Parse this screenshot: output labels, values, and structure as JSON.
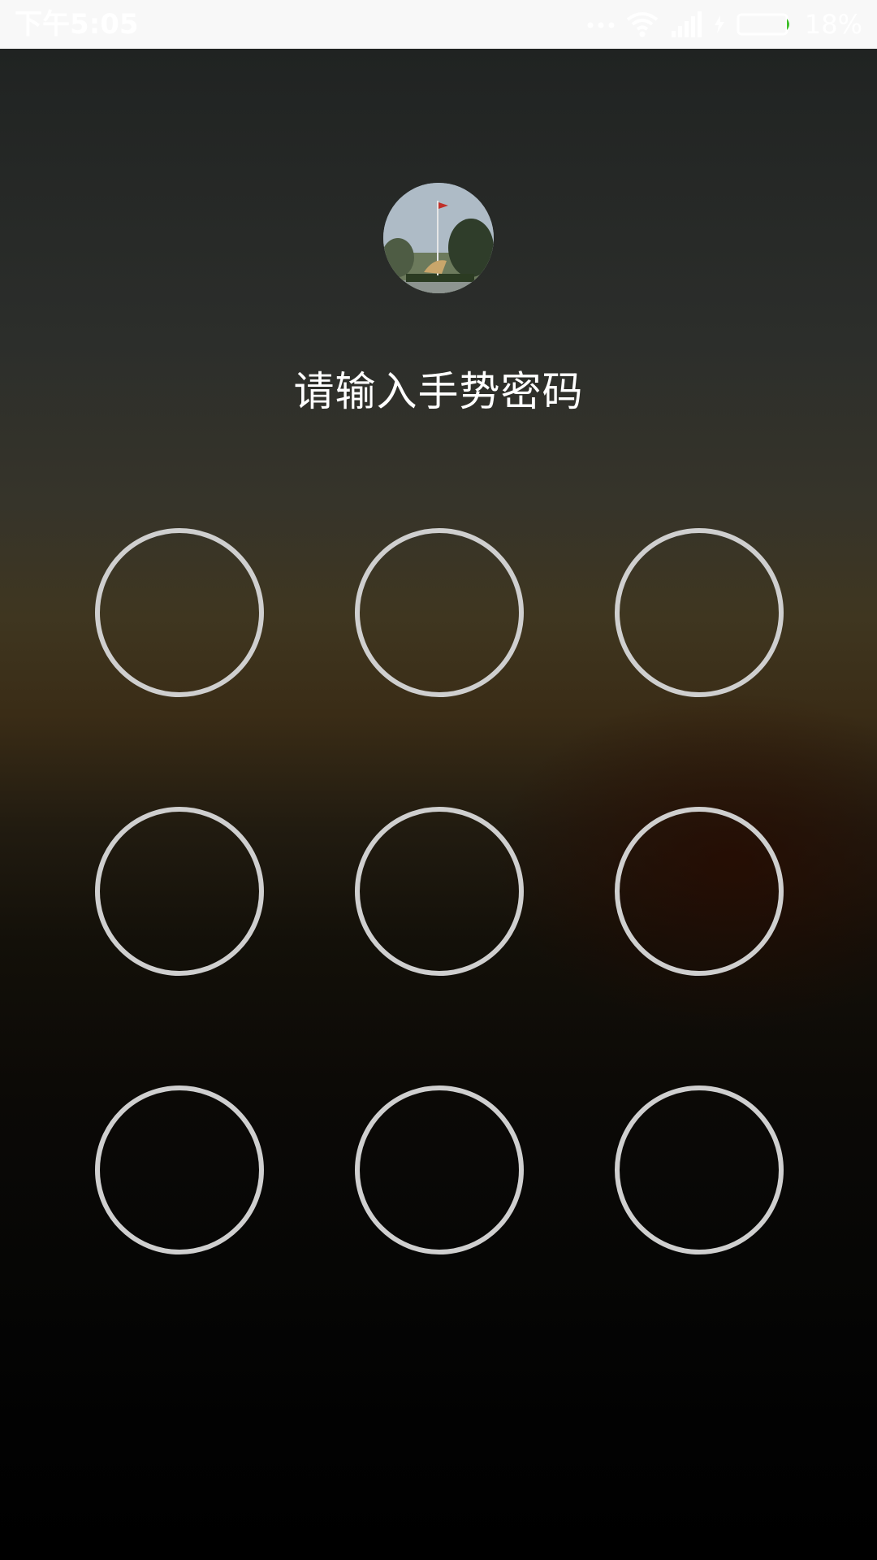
{
  "status_bar": {
    "time": "下午5:05",
    "battery_percent": "18%",
    "battery_level": 0.18,
    "icons": [
      "more-dots-icon",
      "wifi-icon",
      "signal-icon",
      "charging-bolt-icon",
      "battery-icon"
    ]
  },
  "lock": {
    "prompt": "请输入手势密码",
    "avatar_icon": "avatar-photo",
    "grid": {
      "rows": 3,
      "cols": 3,
      "nodes": [
        {
          "id": "1"
        },
        {
          "id": "2"
        },
        {
          "id": "3"
        },
        {
          "id": "4"
        },
        {
          "id": "5"
        },
        {
          "id": "6"
        },
        {
          "id": "7"
        },
        {
          "id": "8"
        },
        {
          "id": "9"
        }
      ]
    }
  },
  "colors": {
    "ring": "#cfcfcf",
    "text": "#ffffff",
    "battery_accent": "#3fbf2a"
  }
}
